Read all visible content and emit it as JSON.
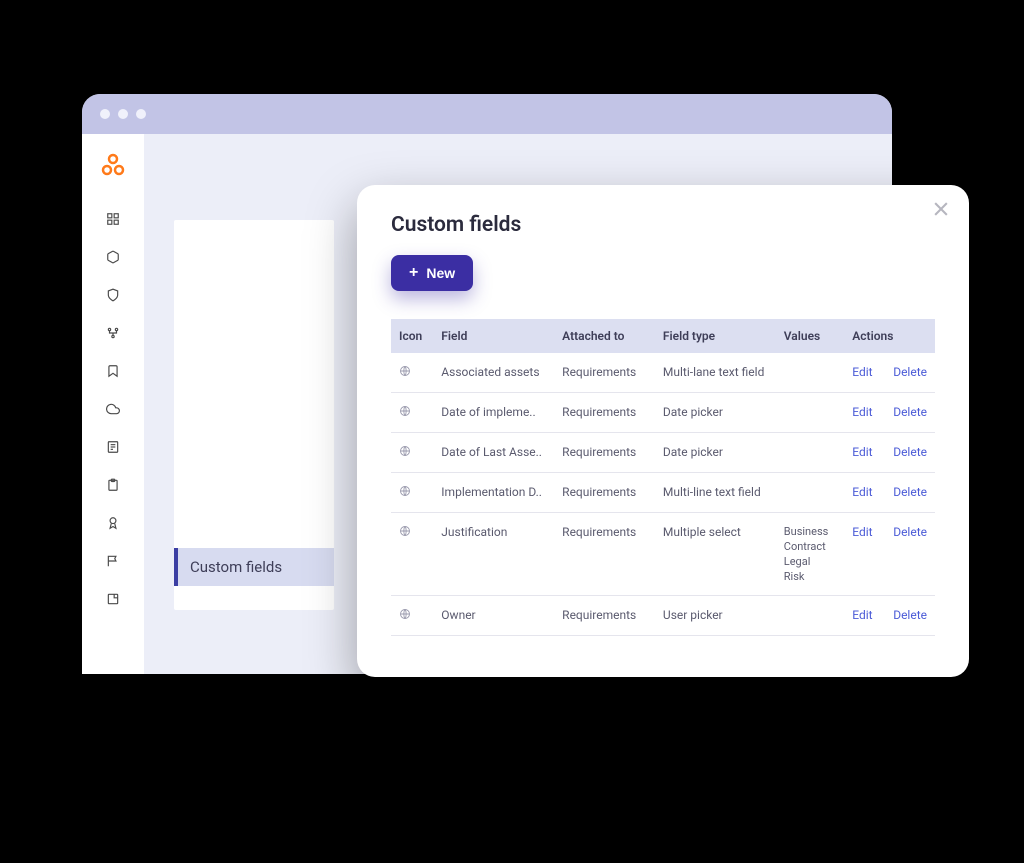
{
  "nav": {
    "active_label": "Custom fields"
  },
  "modal": {
    "title": "Custom fields",
    "new_button": "New",
    "columns": {
      "icon": "Icon",
      "field": "Field",
      "attached": "Attached to",
      "type": "Field type",
      "values": "Values",
      "actions": "Actions"
    },
    "actions": {
      "edit": "Edit",
      "delete": "Delete"
    },
    "rows": [
      {
        "field": "Associated assets",
        "attached": "Requirements",
        "type": "Multi-lane text field",
        "values": []
      },
      {
        "field": "Date of impleme..",
        "attached": "Requirements",
        "type": "Date picker",
        "values": []
      },
      {
        "field": "Date of Last Asse..",
        "attached": "Requirements",
        "type": "Date picker",
        "values": []
      },
      {
        "field": "Implementation D..",
        "attached": "Requirements",
        "type": "Multi-line text field",
        "values": []
      },
      {
        "field": "Justification",
        "attached": "Requirements",
        "type": "Multiple select",
        "values": [
          "Business",
          "Contract",
          "Legal",
          "Risk"
        ]
      },
      {
        "field": "Owner",
        "attached": "Requirements",
        "type": "User picker",
        "values": []
      }
    ]
  }
}
